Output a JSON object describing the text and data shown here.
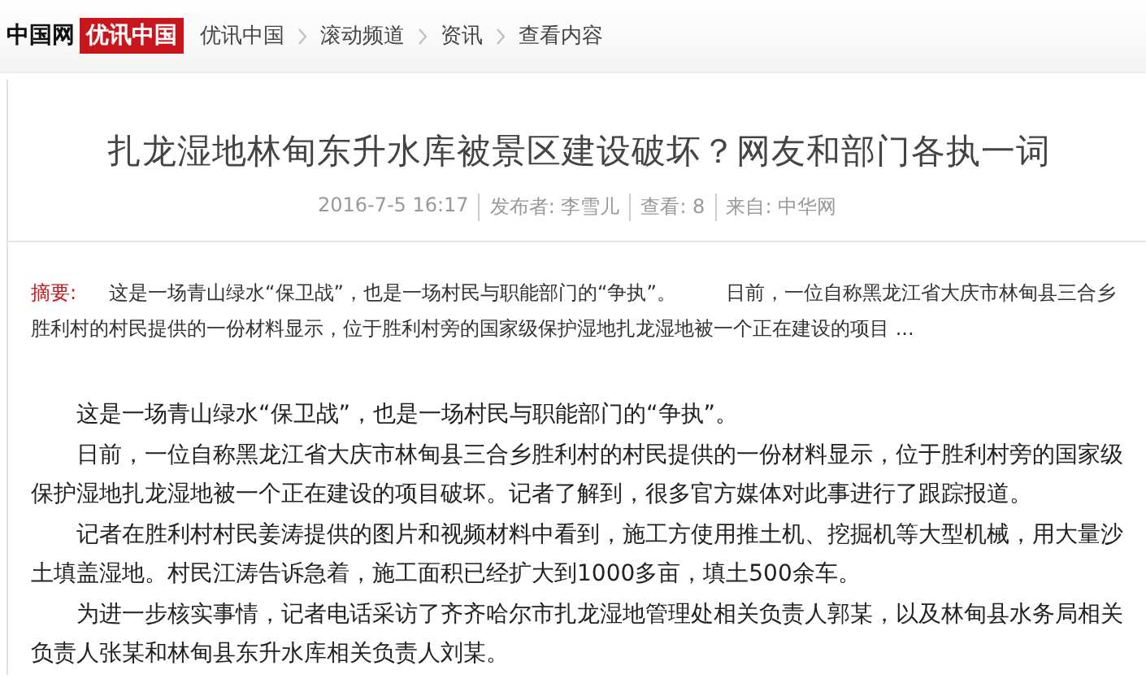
{
  "header": {
    "logo": "中国网",
    "logo_badge": "优讯中国",
    "breadcrumbs": [
      "优讯中国",
      "滚动频道",
      "资讯",
      "查看内容"
    ]
  },
  "article": {
    "title": "扎龙湿地林甸东升水库被景区建设破坏？网友和部门各执一词",
    "meta": [
      "2016-7-5 16:17",
      "发布者: 李雪儿",
      "查看: 8",
      "来自: 中华网"
    ],
    "summary_label": "摘要:",
    "summary": "这是一场青山绿水“保卫战”，也是一场村民与职能部门的“争执”。        日前，一位自称黑龙江省大庆市林甸县三合乡胜利村的村民提供的一份材料显示，位于胜利村旁的国家级保护湿地扎龙湿地被一个正在建设的项目 ...",
    "paragraphs": [
      "这是一场青山绿水“保卫战”，也是一场村民与职能部门的“争执”。",
      "日前，一位自称黑龙江省大庆市林甸县三合乡胜利村的村民提供的一份材料显示，位于胜利村旁的国家级保护湿地扎龙湿地被一个正在建设的项目破坏。记者了解到，很多官方媒体对此事进行了跟踪报道。",
      "记者在胜利村村民姜涛提供的图片和视频材料中看到，施工方使用推土机、挖掘机等大型机械，用大量沙土填盖湿地。村民江涛告诉急着，施工面积已经扩大到1000多亩，填土500余车。",
      "为进一步核实事情，记者电话采访了齐齐哈尔市扎龙湿地管理处相关负责人郭某，以及林甸县水务局相关负责人张某和林甸县东升水库相关负责人刘某。"
    ]
  }
}
